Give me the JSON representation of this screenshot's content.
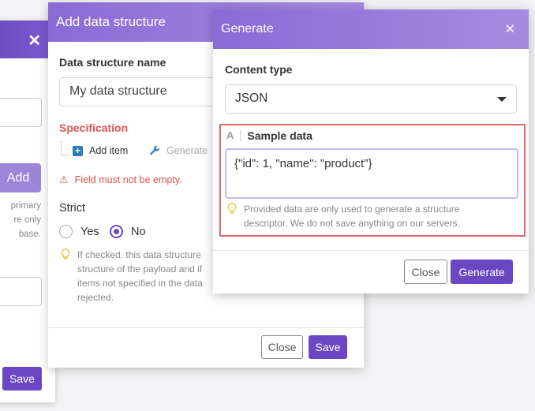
{
  "back_modal": {
    "add_label": "Add",
    "hint_fragments": [
      "primary",
      "re only",
      "base."
    ],
    "save_label": "Save"
  },
  "structure_modal": {
    "title": "Add data structure",
    "name_label": "Data structure name",
    "name_value": "My data structure",
    "spec_label": "Specification",
    "add_item_label": "Add item",
    "generate_label": "Generate",
    "error_text": "Field must not be empty.",
    "strict_label": "Strict",
    "strict_options": [
      "Yes",
      "No"
    ],
    "strict_selected": "No",
    "strict_hint_lines": [
      "If checked, this data structure",
      "structure of the payload and if",
      "items not specified in the data",
      "rejected."
    ],
    "close_label": "Close",
    "save_label": "Save"
  },
  "generate_modal": {
    "title": "Generate",
    "content_type_label": "Content type",
    "content_type_value": "JSON",
    "sample_type_glyph": "A",
    "sample_label": "Sample data",
    "sample_value": "{\"id\": 1, \"name\": \"product\"}",
    "hint_line1": "Provided data are only used to generate a structure",
    "hint_line2": "descriptor. We do not save anything on our servers.",
    "close_label": "Close",
    "generate_label": "Generate"
  },
  "colors": {
    "brand_purple": "#6c47c4",
    "header_gradient": [
      "#8a6bd5",
      "#a58ce2"
    ],
    "error_red": "#e05454"
  },
  "icons": {
    "close": "close-icon",
    "add": "plus-square-icon",
    "generate": "wrench-icon",
    "warning": "warning-triangle-icon",
    "hint": "lightbulb-icon",
    "dropdown": "caret-down-icon"
  }
}
